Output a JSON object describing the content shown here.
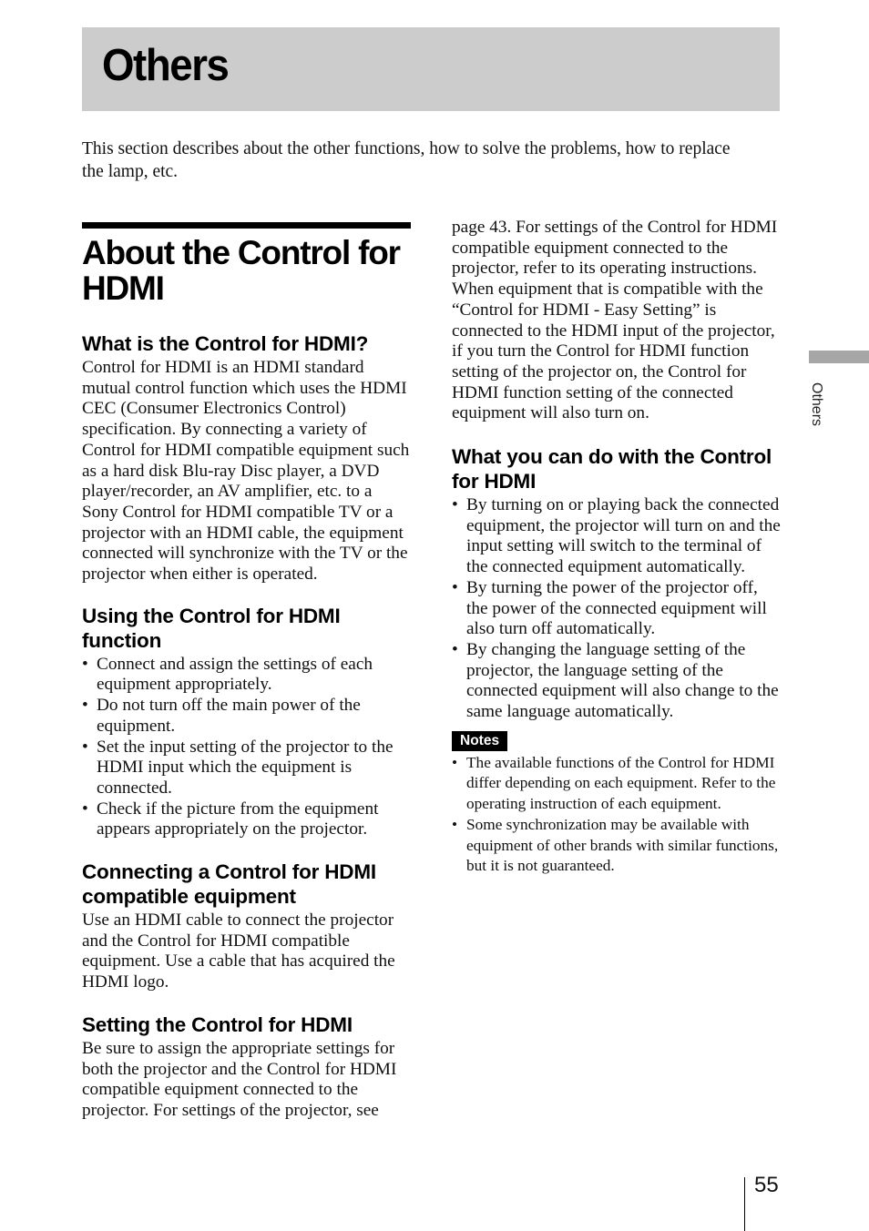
{
  "chapter": {
    "title": "Others",
    "intro": "This section describes about the other functions, how to solve the problems, how to replace the lamp, etc."
  },
  "section": {
    "title_line1": "About the Control for",
    "title_line2": "HDMI"
  },
  "what_is": {
    "heading": "What is the Control for HDMI?",
    "body": "Control for HDMI is an HDMI standard mutual control function which uses the HDMI CEC (Consumer Electronics Control) specification. By connecting a variety of Control for HDMI compatible equipment such as a hard disk Blu-ray Disc player, a DVD player/recorder, an AV amplifier, etc. to a Sony Control for HDMI compatible TV or a projector with an HDMI cable, the equipment connected will synchronize with the TV or the projector when either is operated."
  },
  "using": {
    "heading": "Using the Control for HDMI function",
    "bullets": [
      "Connect and assign the settings of each equipment appropriately.",
      "Do not turn off the main power of the equipment.",
      "Set the input setting of the projector to the HDMI input which the equipment is connected.",
      "Check if the picture from the equipment appears appropriately on the projector."
    ]
  },
  "connecting": {
    "heading": "Connecting a Control for HDMI compatible equipment",
    "body": "Use an HDMI cable to connect the projector and the Control for HDMI compatible equipment. Use a cable that has acquired the HDMI logo."
  },
  "setting": {
    "heading": "Setting the Control for HDMI",
    "body_part1": "Be sure to assign the appropriate settings for both the projector and the Control for HDMI compatible equipment connected to the projector. For settings of the projector, see",
    "body_part2": "page 43. For settings of the Control for HDMI compatible equipment connected to the projector, refer to its operating instructions. When equipment that is compatible with the “Control for HDMI - Easy Setting” is connected to the HDMI input of the projector, if you turn the Control for HDMI function setting of the projector on, the Control for HDMI function setting of the connected equipment will also turn on."
  },
  "what_you_can_do": {
    "heading": "What you can do with the Control for HDMI",
    "bullets": [
      "By turning on or playing back the connected equipment, the projector will turn on and the input setting will switch to the terminal of the connected equipment automatically.",
      "By turning the power of the projector off, the power of the connected equipment will also turn off automatically.",
      "By changing the language setting of the projector, the language setting of the connected equipment will also change to the same language automatically."
    ]
  },
  "notes": {
    "badge": "Notes",
    "items": [
      "The available functions of the Control for HDMI differ depending on each equipment. Refer to the operating instruction of each equipment.",
      "Some synchronization may be available with equipment of other brands with similar functions, but it is not guaranteed."
    ]
  },
  "side_tab": {
    "label": "Others"
  },
  "footer": {
    "page_number": "55"
  }
}
